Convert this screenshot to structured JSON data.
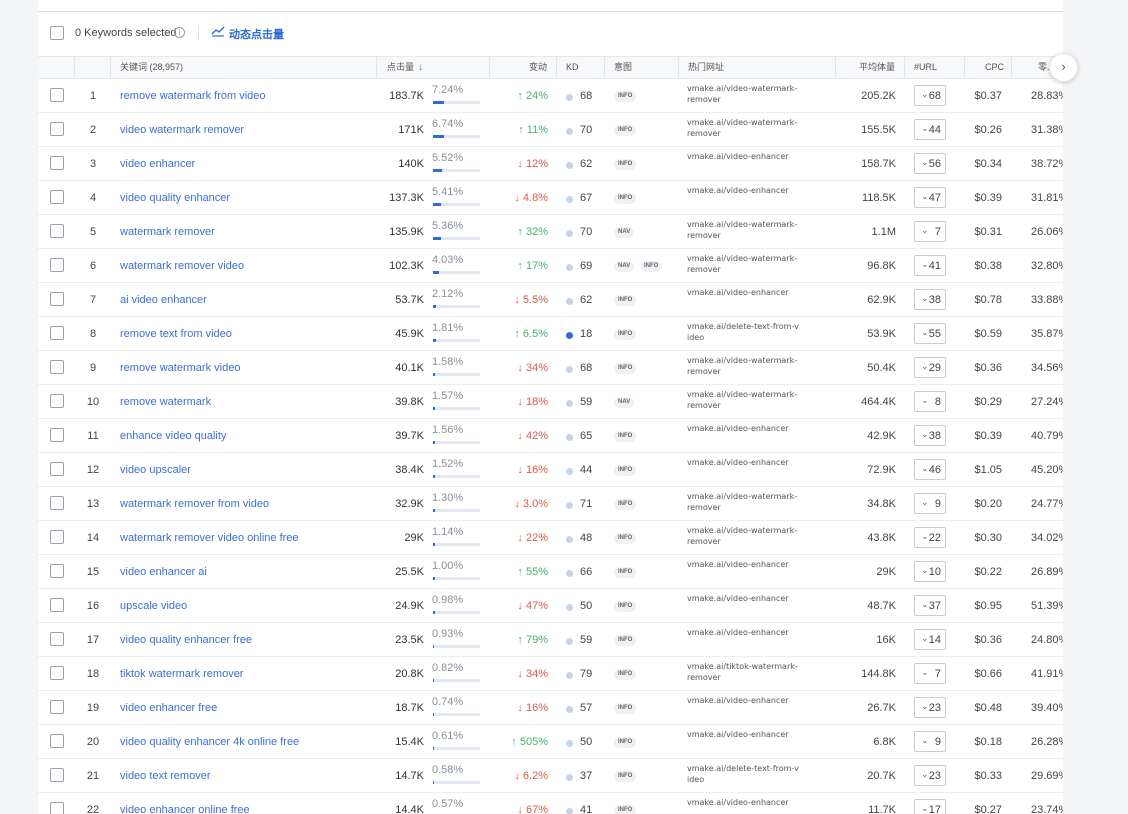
{
  "toolbar": {
    "selected_label": "0 Keywords selected",
    "info_glyph": "i",
    "dynamic_label": "动态点击量"
  },
  "headers": {
    "keyword": "关键词 (28,957)",
    "clicks": "点击量",
    "sort_glyph": "↓",
    "change": "变动",
    "kd": "KD",
    "intent": "意图",
    "top_url": "热门网址",
    "avg_volume": "平均体量",
    "url_count": "#URL",
    "cpc": "CPC",
    "zero": "零..."
  },
  "next_glyph": "›",
  "rows": [
    {
      "num": "1",
      "keyword": "remove watermark from video",
      "clicks": "183.7K",
      "pct": "7.24%",
      "share": 7.24,
      "dir": "up",
      "change": "↑ 24%",
      "kd": "68",
      "kd_dark": false,
      "intents": [
        "INFO"
      ],
      "url": "vmake.ai/video-watermark-remover",
      "volume": "205.2K",
      "url_count": "68",
      "cpc": "$0.37",
      "zero": "28.83%"
    },
    {
      "num": "2",
      "keyword": "video watermark remover",
      "clicks": "171K",
      "pct": "6.74%",
      "share": 6.74,
      "dir": "up",
      "change": "↑ 11%",
      "kd": "70",
      "kd_dark": false,
      "intents": [
        "INFO"
      ],
      "url": "vmake.ai/video-watermark-remover",
      "volume": "155.5K",
      "url_count": "44",
      "cpc": "$0.26",
      "zero": "31.38%"
    },
    {
      "num": "3",
      "keyword": "video enhancer",
      "clicks": "140K",
      "pct": "5.52%",
      "share": 5.52,
      "dir": "down",
      "change": "↓ 12%",
      "kd": "62",
      "kd_dark": false,
      "intents": [
        "INFO"
      ],
      "url": "vmake.ai/video-enhancer",
      "volume": "158.7K",
      "url_count": "56",
      "cpc": "$0.34",
      "zero": "38.72%"
    },
    {
      "num": "4",
      "keyword": "video quality enhancer",
      "clicks": "137.3K",
      "pct": "5.41%",
      "share": 5.41,
      "dir": "down",
      "change": "↓ 4.8%",
      "kd": "67",
      "kd_dark": false,
      "intents": [
        "INFO"
      ],
      "url": "vmake.ai/video-enhancer",
      "volume": "118.5K",
      "url_count": "47",
      "cpc": "$0.39",
      "zero": "31.81%"
    },
    {
      "num": "5",
      "keyword": "watermark remover",
      "clicks": "135.9K",
      "pct": "5.36%",
      "share": 5.36,
      "dir": "up",
      "change": "↑ 32%",
      "kd": "70",
      "kd_dark": false,
      "intents": [
        "NAV"
      ],
      "url": "vmake.ai/video-watermark-remover",
      "volume": "1.1M",
      "url_count": "7",
      "cpc": "$0.31",
      "zero": "26.06%"
    },
    {
      "num": "6",
      "keyword": "watermark remover video",
      "clicks": "102.3K",
      "pct": "4.03%",
      "share": 4.03,
      "dir": "up",
      "change": "↑ 17%",
      "kd": "69",
      "kd_dark": false,
      "intents": [
        "NAV",
        "INFO"
      ],
      "url": "vmake.ai/video-watermark-remover",
      "volume": "96.8K",
      "url_count": "41",
      "cpc": "$0.38",
      "zero": "32.80%"
    },
    {
      "num": "7",
      "keyword": "ai video enhancer",
      "clicks": "53.7K",
      "pct": "2.12%",
      "share": 2.12,
      "dir": "down",
      "change": "↓ 5.5%",
      "kd": "62",
      "kd_dark": false,
      "intents": [
        "INFO"
      ],
      "url": "vmake.ai/video-enhancer",
      "volume": "62.9K",
      "url_count": "38",
      "cpc": "$0.78",
      "zero": "33.88%"
    },
    {
      "num": "8",
      "keyword": "remove text from video",
      "clicks": "45.9K",
      "pct": "1.81%",
      "share": 1.81,
      "dir": "up",
      "change": "↑ 6.5%",
      "kd": "18",
      "kd_dark": true,
      "intents": [
        "INFO"
      ],
      "url": "vmake.ai/delete-text-from-video",
      "volume": "53.9K",
      "url_count": "55",
      "cpc": "$0.59",
      "zero": "35.87%"
    },
    {
      "num": "9",
      "keyword": "remove watermark video",
      "clicks": "40.1K",
      "pct": "1.58%",
      "share": 1.58,
      "dir": "down",
      "change": "↓ 34%",
      "kd": "68",
      "kd_dark": false,
      "intents": [
        "INFO"
      ],
      "url": "vmake.ai/video-watermark-remover",
      "volume": "50.4K",
      "url_count": "29",
      "cpc": "$0.36",
      "zero": "34.56%"
    },
    {
      "num": "10",
      "keyword": "remove watermark",
      "clicks": "39.8K",
      "pct": "1.57%",
      "share": 1.57,
      "dir": "down",
      "change": "↓ 18%",
      "kd": "59",
      "kd_dark": false,
      "intents": [
        "NAV"
      ],
      "url": "vmake.ai/video-watermark-remover",
      "volume": "464.4K",
      "url_count": "8",
      "cpc": "$0.29",
      "zero": "27.24%"
    },
    {
      "num": "11",
      "keyword": "enhance video quality",
      "clicks": "39.7K",
      "pct": "1.56%",
      "share": 1.56,
      "dir": "down",
      "change": "↓ 42%",
      "kd": "65",
      "kd_dark": false,
      "intents": [
        "INFO"
      ],
      "url": "vmake.ai/video-enhancer",
      "volume": "42.9K",
      "url_count": "38",
      "cpc": "$0.39",
      "zero": "40.79%"
    },
    {
      "num": "12",
      "keyword": "video upscaler",
      "clicks": "38.4K",
      "pct": "1.52%",
      "share": 1.52,
      "dir": "down",
      "change": "↓ 16%",
      "kd": "44",
      "kd_dark": false,
      "intents": [
        "INFO"
      ],
      "url": "vmake.ai/video-enhancer",
      "volume": "72.9K",
      "url_count": "46",
      "cpc": "$1.05",
      "zero": "45.20%"
    },
    {
      "num": "13",
      "keyword": "watermark remover from video",
      "clicks": "32.9K",
      "pct": "1.30%",
      "share": 1.3,
      "dir": "down",
      "change": "↓ 3.0%",
      "kd": "71",
      "kd_dark": false,
      "intents": [
        "INFO"
      ],
      "url": "vmake.ai/video-watermark-remover",
      "volume": "34.8K",
      "url_count": "9",
      "cpc": "$0.20",
      "zero": "24.77%"
    },
    {
      "num": "14",
      "keyword": "watermark remover video online free",
      "clicks": "29K",
      "pct": "1.14%",
      "share": 1.14,
      "dir": "down",
      "change": "↓ 22%",
      "kd": "48",
      "kd_dark": false,
      "intents": [
        "INFO"
      ],
      "url": "vmake.ai/video-watermark-remover",
      "volume": "43.8K",
      "url_count": "22",
      "cpc": "$0.30",
      "zero": "34.02%"
    },
    {
      "num": "15",
      "keyword": "video enhancer ai",
      "clicks": "25.5K",
      "pct": "1.00%",
      "share": 1.0,
      "dir": "up",
      "change": "↑ 55%",
      "kd": "66",
      "kd_dark": false,
      "intents": [
        "INFO"
      ],
      "url": "vmake.ai/video-enhancer",
      "volume": "29K",
      "url_count": "10",
      "cpc": "$0.22",
      "zero": "26.89%"
    },
    {
      "num": "16",
      "keyword": "upscale video",
      "clicks": "24.9K",
      "pct": "0.98%",
      "share": 0.98,
      "dir": "down",
      "change": "↓ 47%",
      "kd": "50",
      "kd_dark": false,
      "intents": [
        "INFO"
      ],
      "url": "vmake.ai/video-enhancer",
      "volume": "48.7K",
      "url_count": "37",
      "cpc": "$0.95",
      "zero": "51.39%"
    },
    {
      "num": "17",
      "keyword": "video quality enhancer free",
      "clicks": "23.5K",
      "pct": "0.93%",
      "share": 0.93,
      "dir": "up",
      "change": "↑ 79%",
      "kd": "59",
      "kd_dark": false,
      "intents": [
        "INFO"
      ],
      "url": "vmake.ai/video-enhancer",
      "volume": "16K",
      "url_count": "14",
      "cpc": "$0.36",
      "zero": "24.80%"
    },
    {
      "num": "18",
      "keyword": "tiktok watermark remover",
      "clicks": "20.8K",
      "pct": "0.82%",
      "share": 0.82,
      "dir": "down",
      "change": "↓ 34%",
      "kd": "79",
      "kd_dark": false,
      "intents": [
        "INFO"
      ],
      "url": "vmake.ai/tiktok-watermark-remover",
      "volume": "144.8K",
      "url_count": "7",
      "cpc": "$0.66",
      "zero": "41.91%"
    },
    {
      "num": "19",
      "keyword": "video enhancer free",
      "clicks": "18.7K",
      "pct": "0.74%",
      "share": 0.74,
      "dir": "down",
      "change": "↓ 16%",
      "kd": "57",
      "kd_dark": false,
      "intents": [
        "INFO"
      ],
      "url": "vmake.ai/video-enhancer",
      "volume": "26.7K",
      "url_count": "23",
      "cpc": "$0.48",
      "zero": "39.40%"
    },
    {
      "num": "20",
      "keyword": "video quality enhancer 4k online free",
      "clicks": "15.4K",
      "pct": "0.61%",
      "share": 0.61,
      "dir": "up",
      "change": "↑ 505%",
      "kd": "50",
      "kd_dark": false,
      "intents": [
        "INFO"
      ],
      "url": "vmake.ai/video-enhancer",
      "volume": "6.8K",
      "url_count": "9",
      "cpc": "$0.18",
      "zero": "26.28%"
    },
    {
      "num": "21",
      "keyword": "video text remover",
      "clicks": "14.7K",
      "pct": "0.58%",
      "share": 0.58,
      "dir": "down",
      "change": "↓ 6.2%",
      "kd": "37",
      "kd_dark": false,
      "intents": [
        "INFO"
      ],
      "url": "vmake.ai/delete-text-from-video",
      "volume": "20.7K",
      "url_count": "23",
      "cpc": "$0.33",
      "zero": "29.69%"
    },
    {
      "num": "22",
      "keyword": "video enhancer online free",
      "clicks": "14.4K",
      "pct": "0.57%",
      "share": 0.57,
      "dir": "down",
      "change": "↓ 67%",
      "kd": "41",
      "kd_dark": false,
      "intents": [
        "INFO"
      ],
      "url": "vmake.ai/video-enhancer",
      "volume": "11.7K",
      "url_count": "17",
      "cpc": "$0.27",
      "zero": "23.74%"
    }
  ]
}
